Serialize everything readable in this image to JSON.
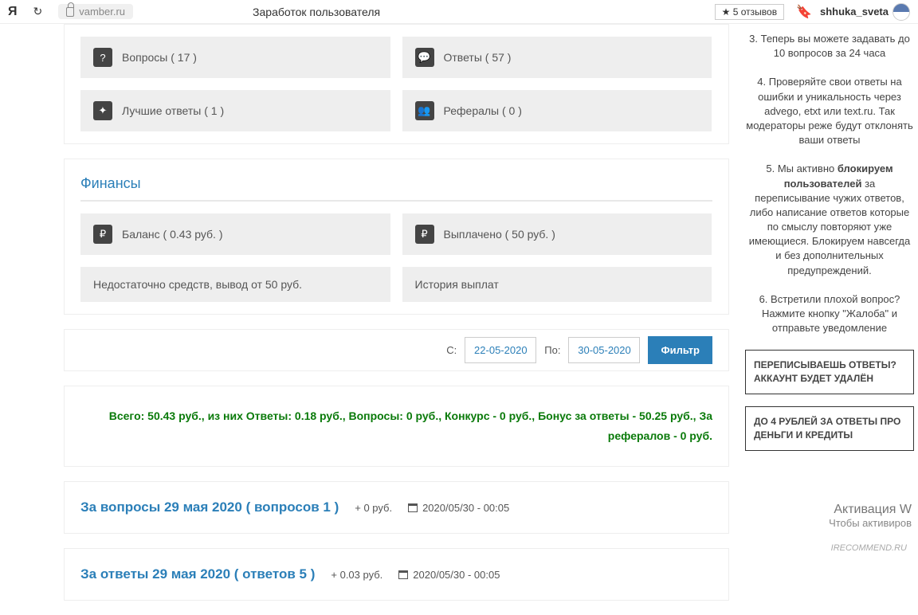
{
  "browser": {
    "ya": "Я",
    "url": "vamber.ru",
    "title": "Заработок пользователя",
    "reviews": "★ 5 отзывов",
    "username": "shhuka_sveta"
  },
  "stats": {
    "questions": "Вопросы ( 17 )",
    "answers": "Ответы ( 57 )",
    "best": "Лучшие ответы ( 1 )",
    "referrals": "Рефералы ( 0 )"
  },
  "finance": {
    "heading": "Финансы",
    "balance": "Баланс ( 0.43 руб. )",
    "paid": "Выплачено ( 50 руб. )",
    "insufficient": "Недостаточно средств, вывод от 50 руб.",
    "history": "История выплат"
  },
  "filter": {
    "from_label": "С:",
    "from_value": "22-05-2020",
    "to_label": "По:",
    "to_value": "30-05-2020",
    "button": "Фильтр"
  },
  "summary": "Всего: 50.43 руб., из них Ответы: 0.18 руб., Вопросы: 0 руб., Конкурс - 0 руб., Бонус за ответы - 50.25 руб., За рефералов - 0 руб.",
  "entries": [
    {
      "title": "За вопросы 29 мая 2020 ( вопросов 1 )",
      "amount": "+ 0 руб.",
      "date": "2020/05/30 - 00:05"
    },
    {
      "title": "За ответы 29 мая 2020 ( ответов 5 )",
      "amount": "+ 0.03 руб.",
      "date": "2020/05/30 - 00:05"
    }
  ],
  "sidebar": {
    "tip3": "3. Теперь вы можете задавать до 10 вопросов за 24 часа",
    "tip4": "4. Проверяйте свои ответы на ошибки и уникальность через advego, etxt или text.ru. Так модераторы реже будут отклонять ваши ответы",
    "tip5a": "5. Мы активно ",
    "tip5bold": "блокируем пользователей",
    "tip5b": " за переписывание чужих ответов, либо написание ответов которые по смыслу повторяют уже имеющиеся. Блокируем навсегда и без дополнительных предупреждений.",
    "tip6": "6. Встретили плохой вопрос? Нажмите кнопку \"Жалоба\" и отправьте уведомление",
    "banner1": "ПЕРЕПИСЫВАЕШЬ ОТВЕТЫ? АККАУНТ БУДЕТ УДАЛЁН",
    "banner2": "ДО 4 РУБЛЕЙ ЗА ОТВЕТЫ ПРО ДЕНЬГИ И КРЕДИТЫ"
  },
  "activation": {
    "line1": "Активация W",
    "line2": "Чтобы активиров"
  },
  "watermark": "IRECOMMEND.RU"
}
